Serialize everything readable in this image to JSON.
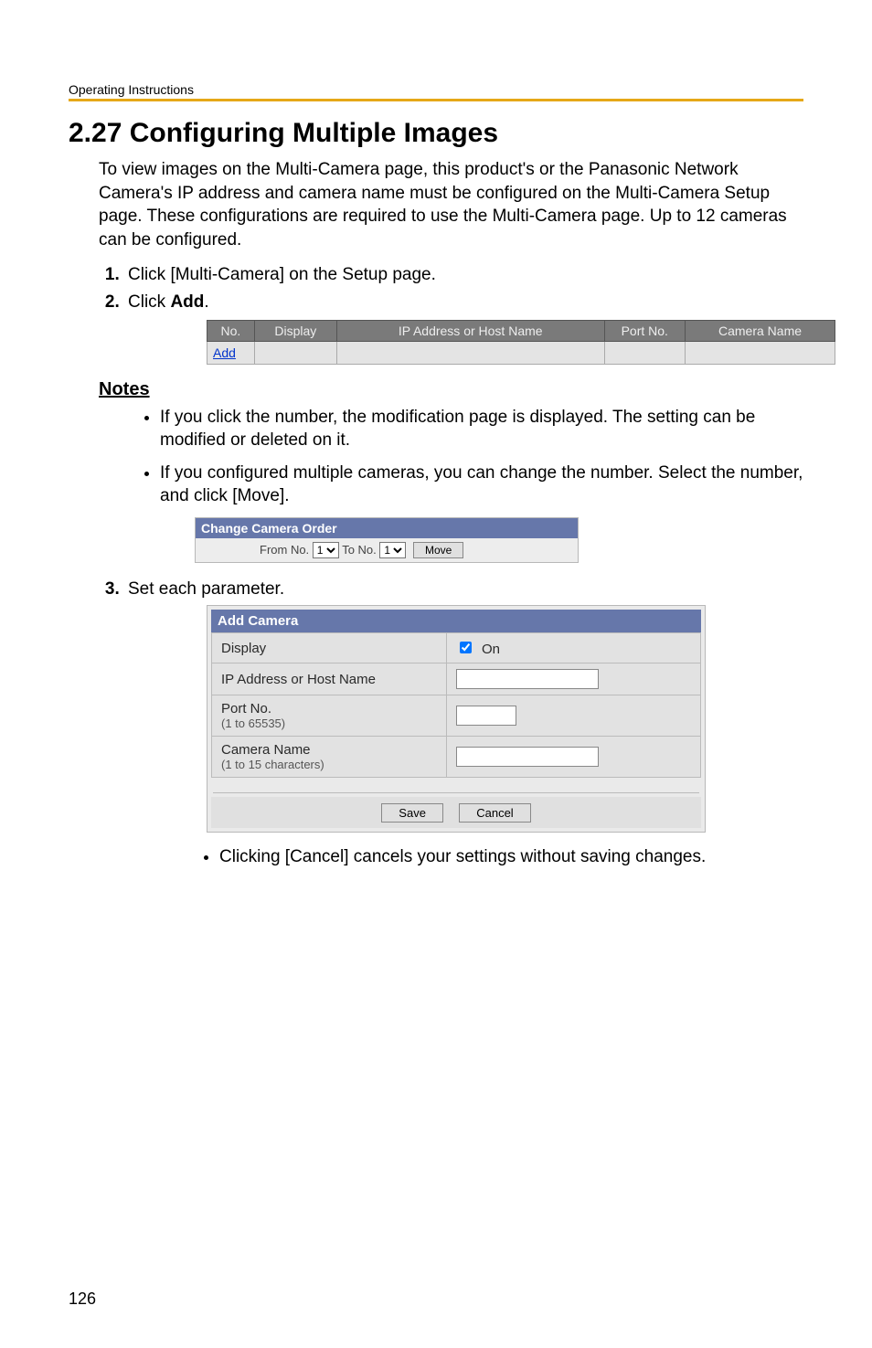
{
  "header": {
    "running_title": "Operating Instructions"
  },
  "title": "2.27  Configuring Multiple Images",
  "intro": "To view images on the Multi-Camera page, this product's or the Panasonic Network Camera's IP address and camera name must be configured on the Multi-Camera Setup page. These configurations are required to use the Multi-Camera page. Up to 12 cameras can be configured.",
  "steps": {
    "one": "Click [Multi-Camera] on the Setup page.",
    "two_prefix": "Click ",
    "two_bold": "Add",
    "two_suffix": ".",
    "three": "Set each parameter."
  },
  "table": {
    "cols": {
      "no": "No.",
      "display": "Display",
      "addr": "IP Address or Host Name",
      "port": "Port No.",
      "name": "Camera Name"
    },
    "add_link": "Add"
  },
  "notes_heading": "Notes",
  "notes": {
    "n1": "If you click the number, the modification page is displayed. The setting can be modified or deleted on it.",
    "n2": "If you configured multiple cameras, you can change the number. Select the number, and click [Move]."
  },
  "cco": {
    "title": "Change Camera Order",
    "from": "From No.",
    "to": " To No.",
    "move": "Move",
    "opt1": "1"
  },
  "addcam": {
    "title": "Add Camera",
    "display": "Display",
    "on": "On",
    "addr": "IP Address or Host Name",
    "port": "Port No.",
    "port_sub": "(1 to 65535)",
    "name": "Camera Name",
    "name_sub": "(1 to 15 characters)",
    "save": "Save",
    "cancel": "Cancel"
  },
  "cancel_note": "Clicking [Cancel] cancels your settings without saving changes.",
  "page_number": "126"
}
